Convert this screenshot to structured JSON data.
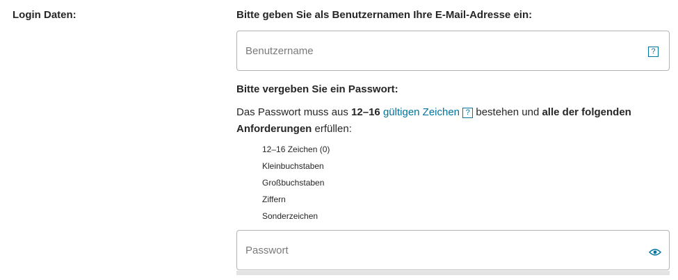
{
  "login": {
    "section_label": "Login Daten:",
    "username_heading": "Bitte geben Sie als Benutzernamen Ihre E-Mail-Adresse ein:",
    "username_placeholder": "Benutzername",
    "username_value": "",
    "help_glyph": "?",
    "password_heading": "Bitte vergeben Sie ein Passwort:",
    "password_desc": {
      "part1": "Das Passwort muss aus ",
      "length_bold": "12–16",
      "link_text": "gültigen Zeichen",
      "part2": " bestehen und ",
      "bold2": "alle der folgenden Anforderungen",
      "part3": " erfüllen:"
    },
    "requirements": [
      "12–16 Zeichen (0)",
      "Kleinbuchstaben",
      "Großbuchstaben",
      "Ziffern",
      "Sonderzeichen"
    ],
    "password_placeholder": "Passwort",
    "password_value": "",
    "accent_color": "#00739f",
    "icons": {
      "help": "help-icon",
      "show_password": "eye-icon"
    }
  }
}
